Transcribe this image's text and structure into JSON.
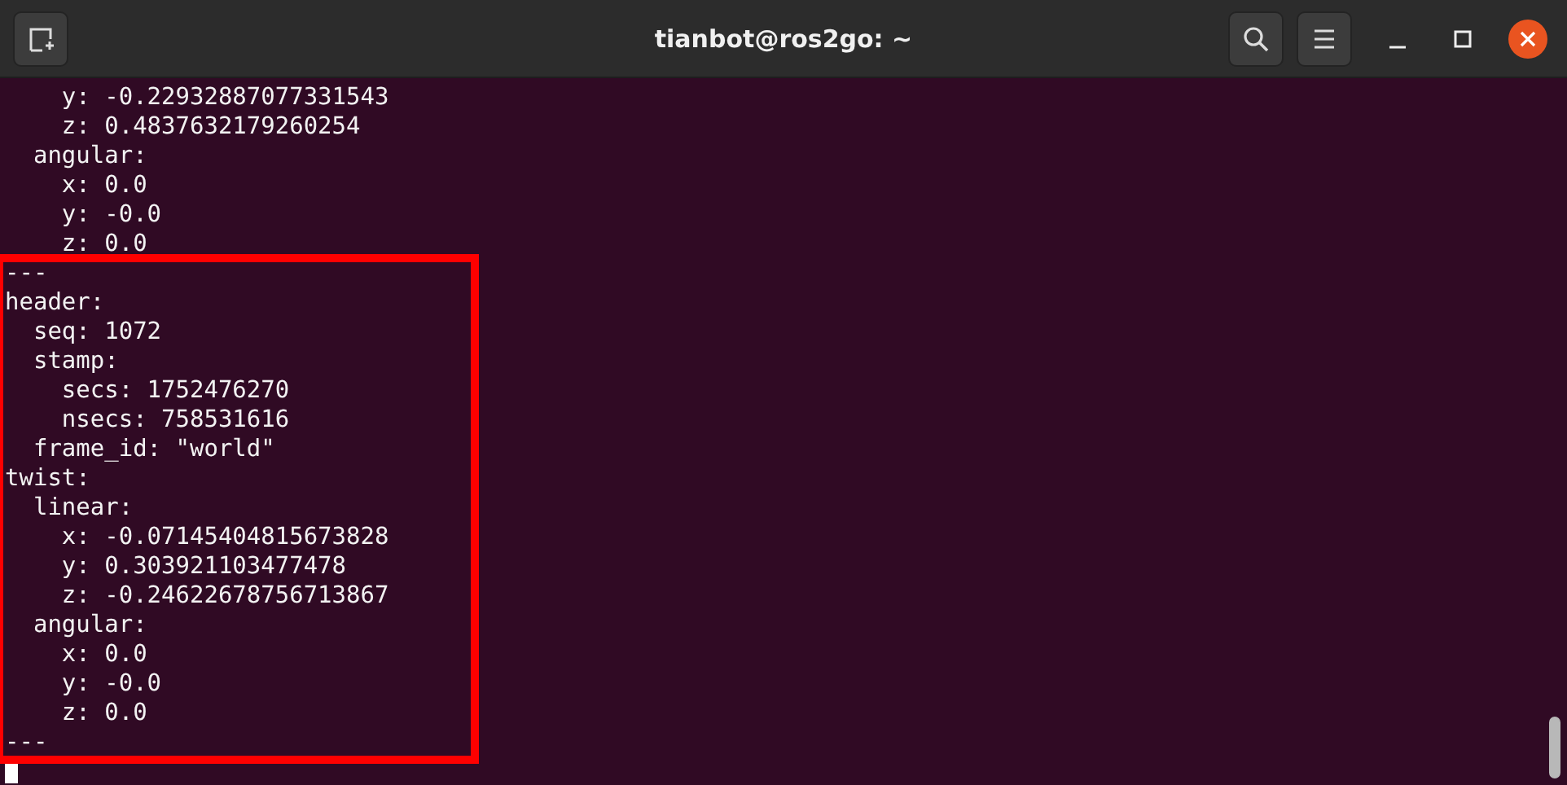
{
  "window": {
    "title": "tianbot@ros2go: ~"
  },
  "terminal": {
    "lines": [
      "    y: -0.22932887077331543",
      "    z: 0.4837632179260254",
      "  angular:",
      "    x: 0.0",
      "    y: -0.0",
      "    z: 0.0"
    ],
    "highlighted_block": {
      "lines": [
        "---",
        "header:",
        "  seq: 1072",
        "  stamp:",
        "    secs: 1752476270",
        "    nsecs: 758531616",
        "  frame_id: \"world\"",
        "twist:",
        "  linear:",
        "    x: -0.07145404815673828",
        "    y: 0.303921103477478",
        "    z: -0.24622678756713867",
        "  angular:",
        "    x: 0.0",
        "    y: -0.0",
        "    z: 0.0",
        "---"
      ]
    },
    "cursor": true
  }
}
